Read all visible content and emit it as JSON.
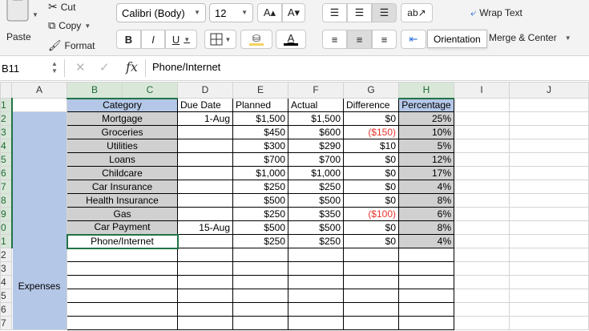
{
  "ribbon": {
    "clipboard": {
      "cut_label": "Cut",
      "copy_label": "Copy",
      "format_label": "Format",
      "paste_label": "Paste"
    },
    "font": {
      "name": "Calibri (Body)",
      "size": "12",
      "grow": "A▴",
      "shrink": "A▾",
      "bold": "B",
      "italic": "I",
      "underline": "U"
    },
    "alignment": {
      "wrap_text_label": "Wrap Text",
      "merge_center_label": "Merge & Center",
      "orientation_tooltip": "Orientation"
    },
    "colors": {
      "highlight": "#f4d35e",
      "font_color": "#000000"
    }
  },
  "formula_bar": {
    "cell_ref": "B11",
    "fx": "fx",
    "value": "Phone/Internet"
  },
  "columns": [
    "A",
    "B",
    "C",
    "D",
    "E",
    "F",
    "G",
    "H",
    "I",
    "J"
  ],
  "row_numbers": [
    "1",
    "2",
    "3",
    "4",
    "5",
    "6",
    "7",
    "8",
    "9",
    "0",
    "1",
    "2",
    "3",
    "4",
    "5",
    "6",
    "7"
  ],
  "expenses_label": "Expenses",
  "headers": {
    "category": "Category",
    "due_date": "Due Date",
    "planned": "Planned",
    "actual": "Actual",
    "difference": "Difference",
    "percentage": "Percentage"
  },
  "rows": [
    {
      "category": "Mortgage",
      "due_date": "1-Aug",
      "planned": "$1,500",
      "actual": "$1,500",
      "difference": "$0",
      "percentage": "25%"
    },
    {
      "category": "Groceries",
      "due_date": "",
      "planned": "$450",
      "actual": "$600",
      "difference": "($150)",
      "percentage": "10%"
    },
    {
      "category": "Utilities",
      "due_date": "",
      "planned": "$300",
      "actual": "$290",
      "difference": "$10",
      "percentage": "5%"
    },
    {
      "category": "Loans",
      "due_date": "",
      "planned": "$700",
      "actual": "$700",
      "difference": "$0",
      "percentage": "12%"
    },
    {
      "category": "Childcare",
      "due_date": "",
      "planned": "$1,000",
      "actual": "$1,000",
      "difference": "$0",
      "percentage": "17%"
    },
    {
      "category": "Car Insurance",
      "due_date": "",
      "planned": "$250",
      "actual": "$250",
      "difference": "$0",
      "percentage": "4%"
    },
    {
      "category": "Health Insurance",
      "due_date": "",
      "planned": "$500",
      "actual": "$500",
      "difference": "$0",
      "percentage": "8%"
    },
    {
      "category": "Gas",
      "due_date": "",
      "planned": "$250",
      "actual": "$350",
      "difference": "($100)",
      "percentage": "6%"
    },
    {
      "category": "Car Payment",
      "due_date": "15-Aug",
      "planned": "$500",
      "actual": "$500",
      "difference": "$0",
      "percentage": "8%"
    },
    {
      "category": "Phone/Internet",
      "due_date": "",
      "planned": "$250",
      "actual": "$250",
      "difference": "$0",
      "percentage": "4%"
    }
  ]
}
